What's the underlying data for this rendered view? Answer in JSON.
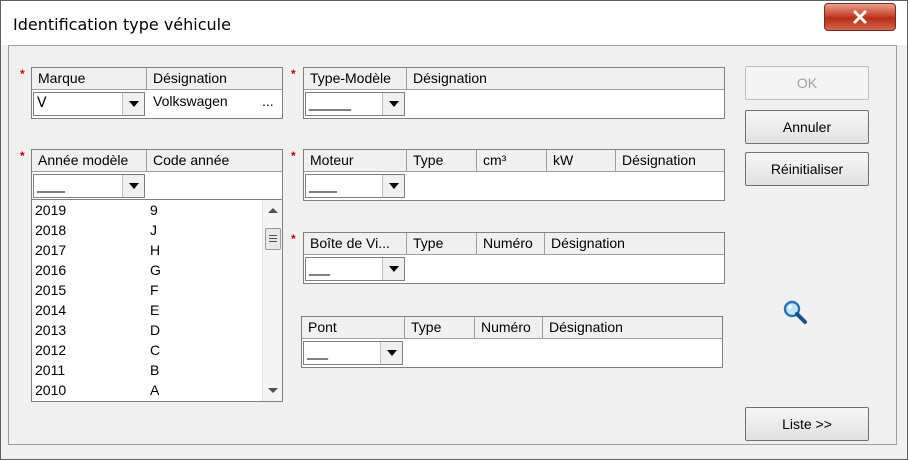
{
  "window": {
    "title": "Identification type véhicule",
    "close_icon": "close-x-icon"
  },
  "required_marker": "*",
  "marque": {
    "headers": [
      "Marque",
      "Désignation"
    ],
    "combo_value": "V",
    "designation": "Volkswagen",
    "ellipsis": "..."
  },
  "type_modele": {
    "headers": [
      "Type-Modèle",
      "Désignation"
    ],
    "combo_value": "______"
  },
  "annee": {
    "headers": [
      "Année modèle",
      "Code année"
    ],
    "combo_value": "____",
    "list": [
      {
        "year": "2019",
        "code": "9"
      },
      {
        "year": "2018",
        "code": "J"
      },
      {
        "year": "2017",
        "code": "H"
      },
      {
        "year": "2016",
        "code": "G"
      },
      {
        "year": "2015",
        "code": "F"
      },
      {
        "year": "2014",
        "code": "E"
      },
      {
        "year": "2013",
        "code": "D"
      },
      {
        "year": "2012",
        "code": "C"
      },
      {
        "year": "2011",
        "code": "B"
      },
      {
        "year": "2010",
        "code": "A"
      }
    ]
  },
  "moteur": {
    "headers": [
      "Moteur",
      "Type",
      "cm³",
      "kW",
      "Désignation"
    ],
    "combo_value": "____"
  },
  "boite": {
    "headers": [
      "Boîte de Vi...",
      "Type",
      "Numéro",
      "Désignation"
    ],
    "combo_value": "___"
  },
  "pont": {
    "headers": [
      "Pont",
      "Type",
      "Numéro",
      "Désignation"
    ],
    "combo_value": "___"
  },
  "buttons": {
    "ok": "OK",
    "annuler": "Annuler",
    "reinitialiser": "Réinitialiser",
    "liste": "Liste >>"
  },
  "icons": {
    "search": "magnifier-icon"
  }
}
